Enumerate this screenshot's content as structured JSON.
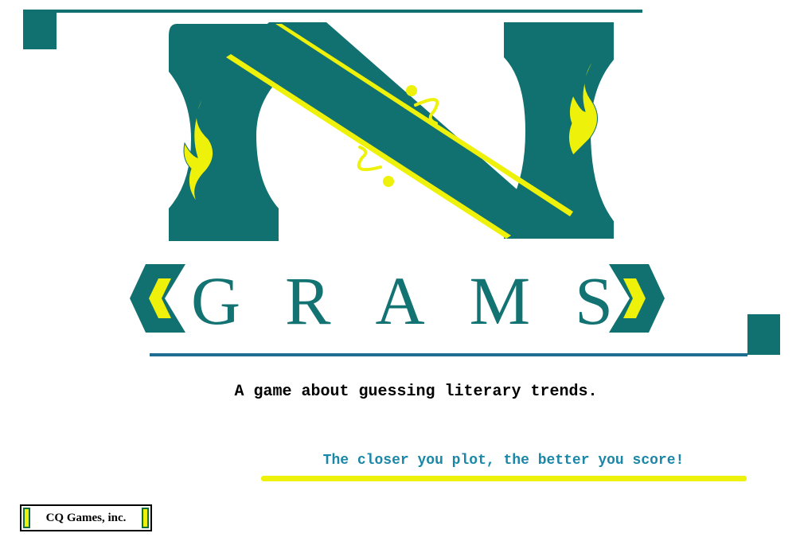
{
  "logo": {
    "letter_icon": "n-monogram-icon",
    "word_letters": [
      "G",
      "R",
      "A",
      "M",
      "S"
    ],
    "left_chevron_icon": "chevron-left-icon",
    "right_chevron_icon": "chevron-right-icon"
  },
  "tagline": "A game about guessing literary trends.",
  "slogan": "The closer you plot, the better you score!",
  "company": "CQ Games, inc.",
  "colors": {
    "teal": "#117070",
    "letter_teal": "#137272",
    "yellow": "#eef10a",
    "slogan_blue": "#1a86a8",
    "rule_blue": "#1f6e92"
  }
}
